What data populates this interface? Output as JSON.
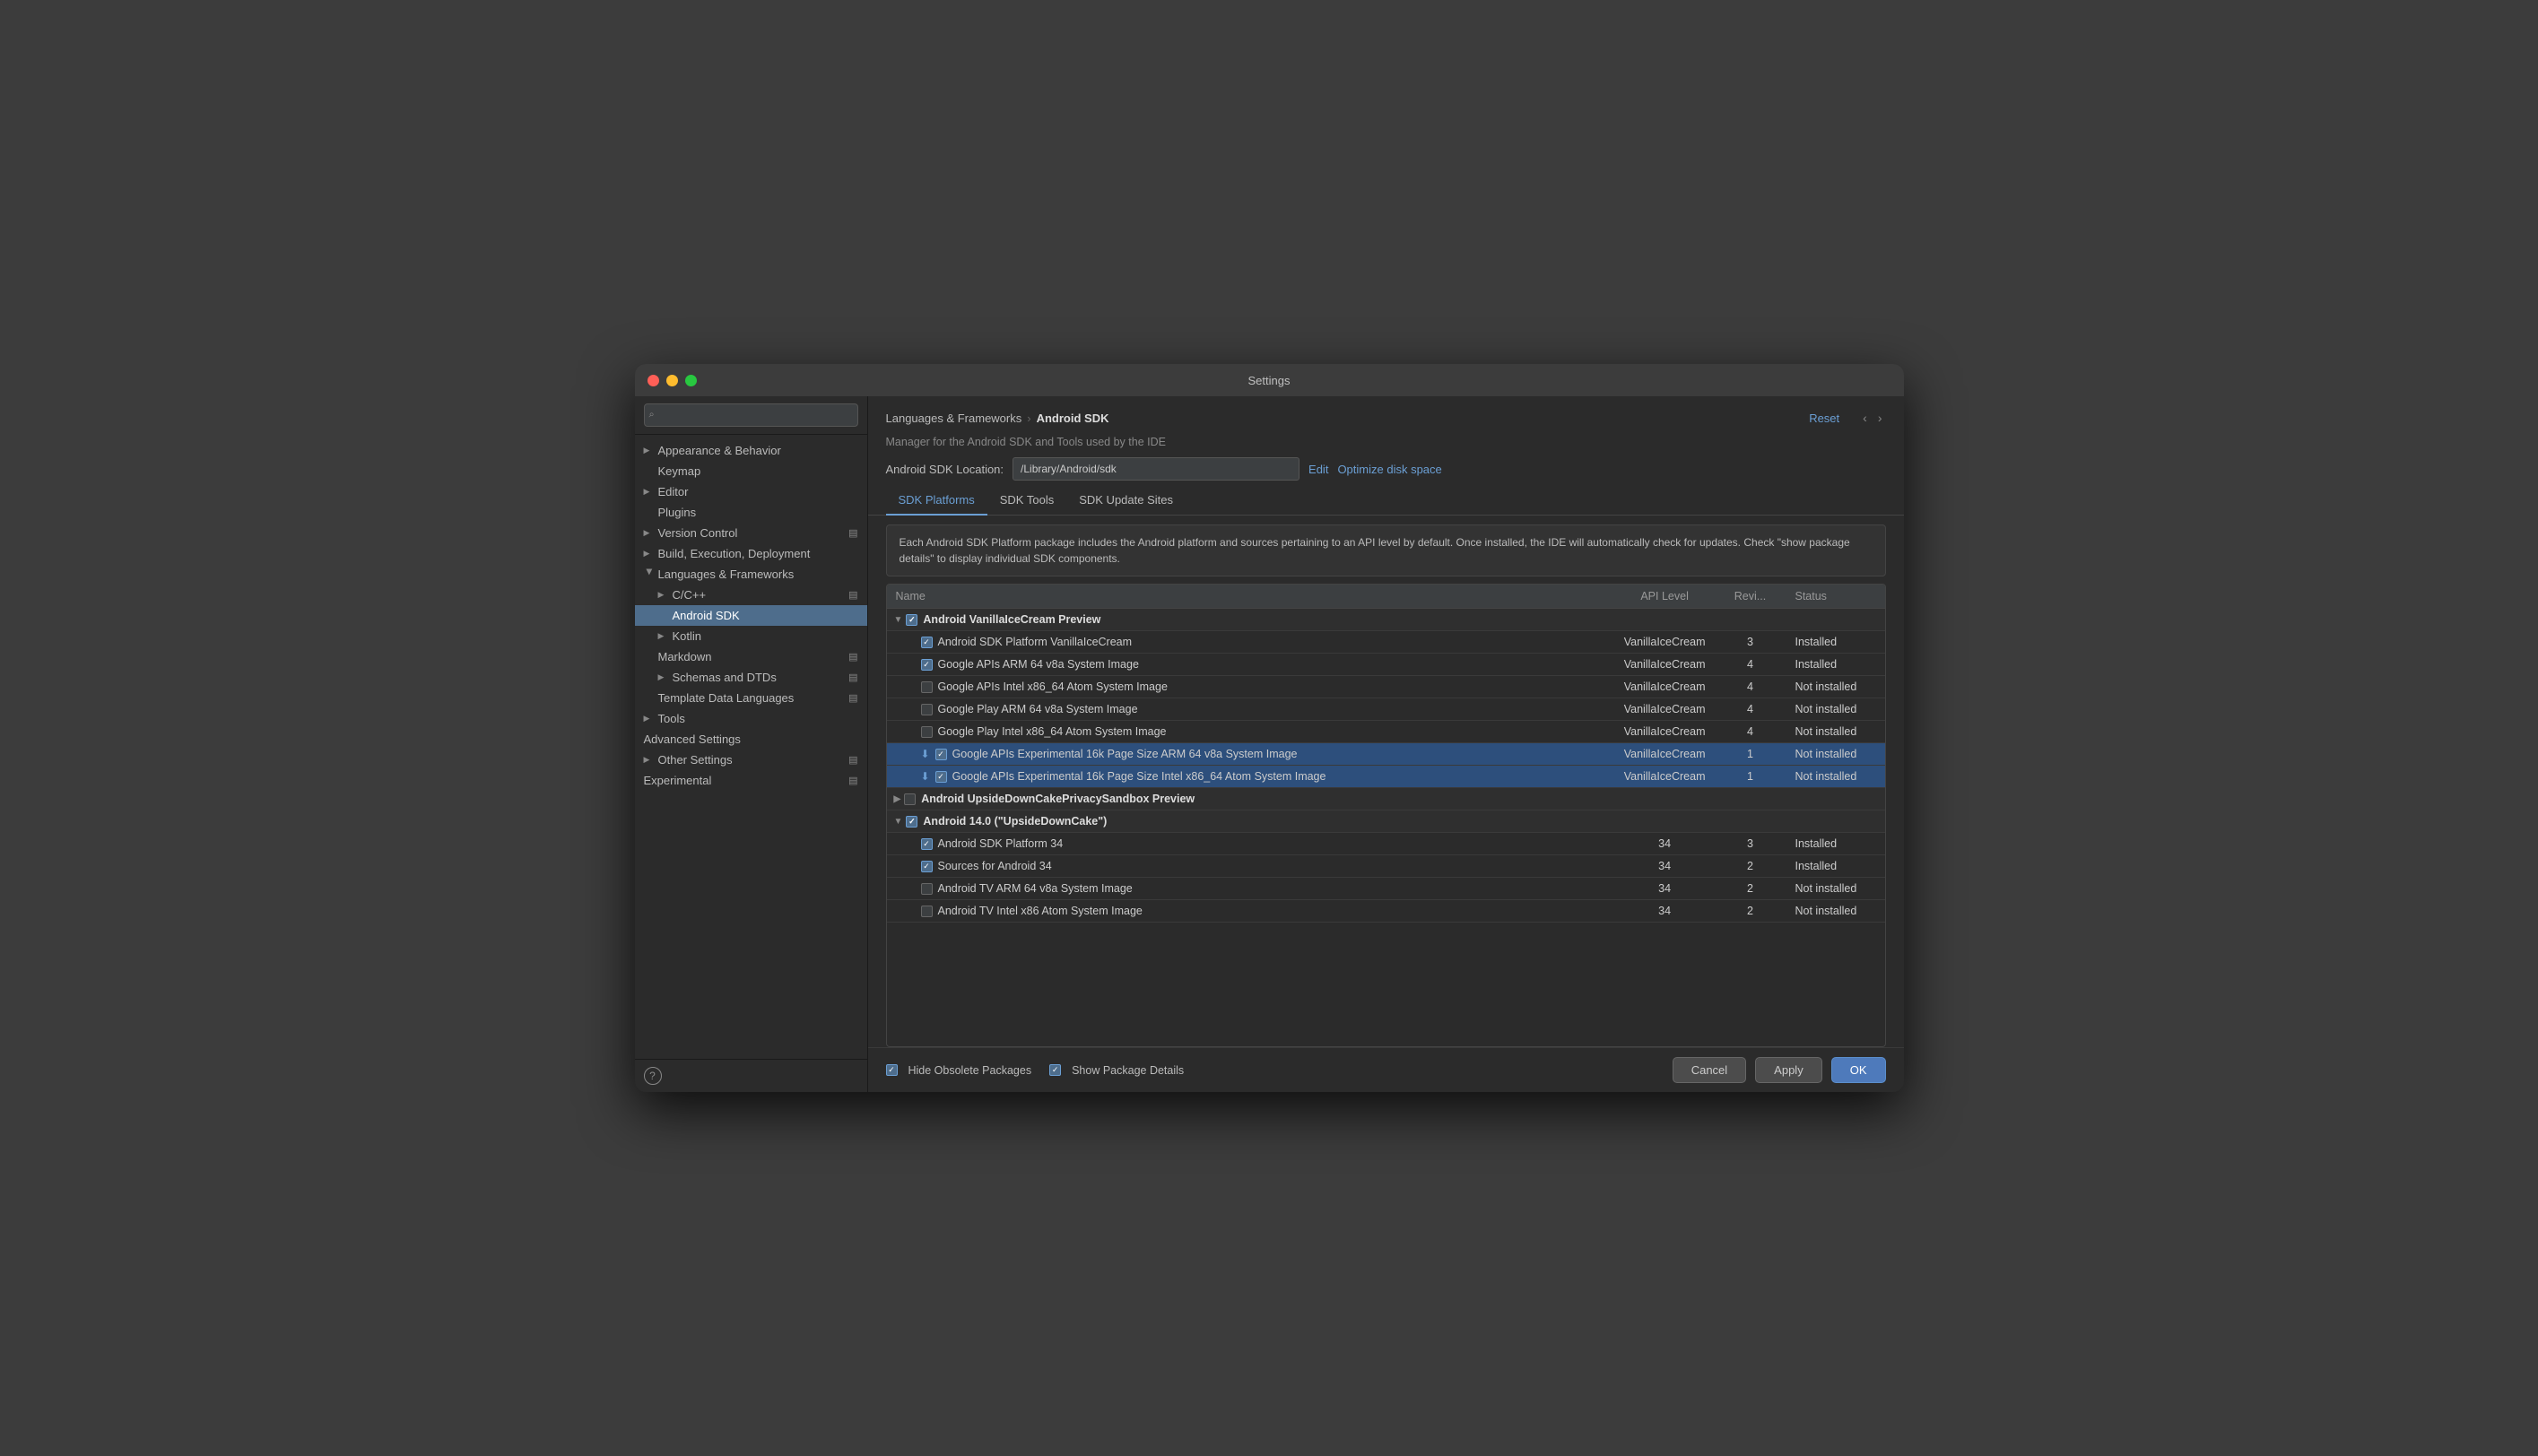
{
  "window": {
    "title": "Settings"
  },
  "sidebar": {
    "search_placeholder": "🔍",
    "items": [
      {
        "id": "appearance",
        "label": "Appearance & Behavior",
        "level": 0,
        "arrow": "▶",
        "has_arrow": true
      },
      {
        "id": "keymap",
        "label": "Keymap",
        "level": 1,
        "has_arrow": false
      },
      {
        "id": "editor",
        "label": "Editor",
        "level": 0,
        "arrow": "▶",
        "has_arrow": true
      },
      {
        "id": "plugins",
        "label": "Plugins",
        "level": 1,
        "has_arrow": false
      },
      {
        "id": "version-control",
        "label": "Version Control",
        "level": 0,
        "arrow": "▶",
        "has_arrow": true
      },
      {
        "id": "build-execution",
        "label": "Build, Execution, Deployment",
        "level": 0,
        "arrow": "▶",
        "has_arrow": true
      },
      {
        "id": "languages-frameworks",
        "label": "Languages & Frameworks",
        "level": 0,
        "arrow": "▼",
        "has_arrow": true,
        "expanded": true
      },
      {
        "id": "cpp",
        "label": "C/C++",
        "level": 1,
        "arrow": "▶",
        "has_arrow": true
      },
      {
        "id": "android-sdk",
        "label": "Android SDK",
        "level": 2,
        "has_arrow": false,
        "selected": true
      },
      {
        "id": "kotlin",
        "label": "Kotlin",
        "level": 1,
        "arrow": "▶",
        "has_arrow": true
      },
      {
        "id": "markdown",
        "label": "Markdown",
        "level": 1,
        "has_arrow": false
      },
      {
        "id": "schemas-dtds",
        "label": "Schemas and DTDs",
        "level": 1,
        "arrow": "▶",
        "has_arrow": true
      },
      {
        "id": "template-data",
        "label": "Template Data Languages",
        "level": 1,
        "has_arrow": false
      },
      {
        "id": "tools",
        "label": "Tools",
        "level": 0,
        "arrow": "▶",
        "has_arrow": true
      },
      {
        "id": "advanced-settings",
        "label": "Advanced Settings",
        "level": 0,
        "has_arrow": false
      },
      {
        "id": "other-settings",
        "label": "Other Settings",
        "level": 0,
        "arrow": "▶",
        "has_arrow": true
      },
      {
        "id": "experimental",
        "label": "Experimental",
        "level": 0,
        "has_arrow": false
      }
    ]
  },
  "breadcrumb": {
    "parent": "Languages & Frameworks",
    "current": "Android SDK"
  },
  "buttons": {
    "reset": "Reset",
    "edit": "Edit",
    "optimize": "Optimize disk space",
    "cancel": "Cancel",
    "apply": "Apply",
    "ok": "OK"
  },
  "panel": {
    "description": "Manager for the Android SDK and Tools used by the IDE",
    "sdk_location_label": "Android SDK Location:",
    "sdk_location_value": "/Library/Android/sdk"
  },
  "tabs": [
    {
      "id": "sdk-platforms",
      "label": "SDK Platforms",
      "active": true
    },
    {
      "id": "sdk-tools",
      "label": "SDK Tools",
      "active": false
    },
    {
      "id": "sdk-update-sites",
      "label": "SDK Update Sites",
      "active": false
    }
  ],
  "info_text": "Each Android SDK Platform package includes the Android platform and sources pertaining to an API level by default. Once installed, the IDE will automatically check for updates. Check \"show package details\" to display individual SDK components.",
  "table": {
    "headers": [
      "Name",
      "API Level",
      "Revi...",
      "Status"
    ],
    "rows": [
      {
        "type": "group",
        "expand": "▼",
        "checked": "blue",
        "name": "Android VanillaIceCream Preview",
        "api": "",
        "rev": "",
        "status": ""
      },
      {
        "type": "item",
        "expand": "",
        "checked": "blue",
        "name": "Android SDK Platform VanillaIceCream",
        "api": "VanillaIceCream",
        "rev": "3",
        "status": "Installed"
      },
      {
        "type": "item",
        "expand": "",
        "checked": "blue",
        "name": "Google APIs ARM 64 v8a System Image",
        "api": "VanillaIceCream",
        "rev": "4",
        "status": "Installed"
      },
      {
        "type": "item",
        "expand": "",
        "checked": "empty",
        "name": "Google APIs Intel x86_64 Atom System Image",
        "api": "VanillaIceCream",
        "rev": "4",
        "status": "Not installed"
      },
      {
        "type": "item",
        "expand": "",
        "checked": "empty",
        "name": "Google Play ARM 64 v8a System Image",
        "api": "VanillaIceCream",
        "rev": "4",
        "status": "Not installed"
      },
      {
        "type": "item",
        "expand": "",
        "checked": "empty",
        "name": "Google Play Intel x86_64 Atom System Image",
        "api": "VanillaIceCream",
        "rev": "4",
        "status": "Not installed"
      },
      {
        "type": "item-highlighted",
        "expand": "",
        "checked": "blue",
        "download": true,
        "name": "Google APIs Experimental 16k Page Size ARM 64 v8a System Image",
        "api": "VanillaIceCream",
        "rev": "1",
        "status": "Not installed"
      },
      {
        "type": "item-highlighted",
        "expand": "",
        "checked": "blue",
        "download": true,
        "name": "Google APIs Experimental 16k Page Size Intel x86_64 Atom System Image",
        "api": "VanillaIceCream",
        "rev": "1",
        "status": "Not installed"
      },
      {
        "type": "group",
        "expand": "▶",
        "checked": "empty",
        "name": "Android UpsideDownCakePrivacySandbox Preview",
        "api": "",
        "rev": "",
        "status": ""
      },
      {
        "type": "group",
        "expand": "▼",
        "checked": "blue",
        "name": "Android 14.0 (\"UpsideDownCake\")",
        "api": "",
        "rev": "",
        "status": ""
      },
      {
        "type": "item",
        "expand": "",
        "checked": "blue",
        "name": "Android SDK Platform 34",
        "api": "34",
        "rev": "3",
        "status": "Installed"
      },
      {
        "type": "item",
        "expand": "",
        "checked": "blue",
        "name": "Sources for Android 34",
        "api": "34",
        "rev": "2",
        "status": "Installed"
      },
      {
        "type": "item",
        "expand": "",
        "checked": "empty",
        "name": "Android TV ARM 64 v8a System Image",
        "api": "34",
        "rev": "2",
        "status": "Not installed"
      },
      {
        "type": "item",
        "expand": "",
        "checked": "empty",
        "name": "Android TV Intel x86 Atom System Image",
        "api": "34",
        "rev": "2",
        "status": "Not installed"
      }
    ]
  },
  "bottom": {
    "hide_obsolete": "Hide Obsolete Packages",
    "show_package": "Show Package Details",
    "hide_checked": true,
    "show_checked": true
  }
}
